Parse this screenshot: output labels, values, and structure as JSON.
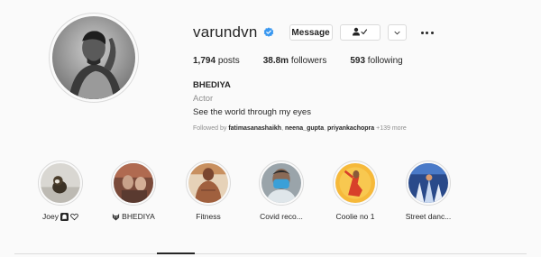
{
  "profile": {
    "username": "varundvn",
    "verified_icon": "verified-badge-icon",
    "message_label": "Message",
    "following_icon": "person-check-icon",
    "dropdown_icon": "chevron-down-icon",
    "more_icon": "more-horizontal-icon",
    "accent": "#3897f0"
  },
  "stats": {
    "posts_count": "1,794",
    "posts_label": "posts",
    "followers_count": "38.8m",
    "followers_label": "followers",
    "following_count": "593",
    "following_label": "following"
  },
  "bio": {
    "name": "BHEDIYA",
    "category": "Actor",
    "text": "See the world through my eyes"
  },
  "followed_by": {
    "prefix": "Followed by",
    "user1": "fatimasanashaikh",
    "user2": "neena_gupta",
    "user3": "priyankachopra",
    "more": "+139 more"
  },
  "highlights": [
    {
      "label": "Joey",
      "icons": [
        "ghost-icon",
        "heart-icon"
      ]
    },
    {
      "label": "BHEDIYA",
      "icons": [
        "wolf-icon"
      ]
    },
    {
      "label": "Fitness",
      "icons": []
    },
    {
      "label": "Covid reco...",
      "icons": []
    },
    {
      "label": "Coolie no 1",
      "icons": []
    },
    {
      "label": "Street danc...",
      "icons": []
    }
  ]
}
